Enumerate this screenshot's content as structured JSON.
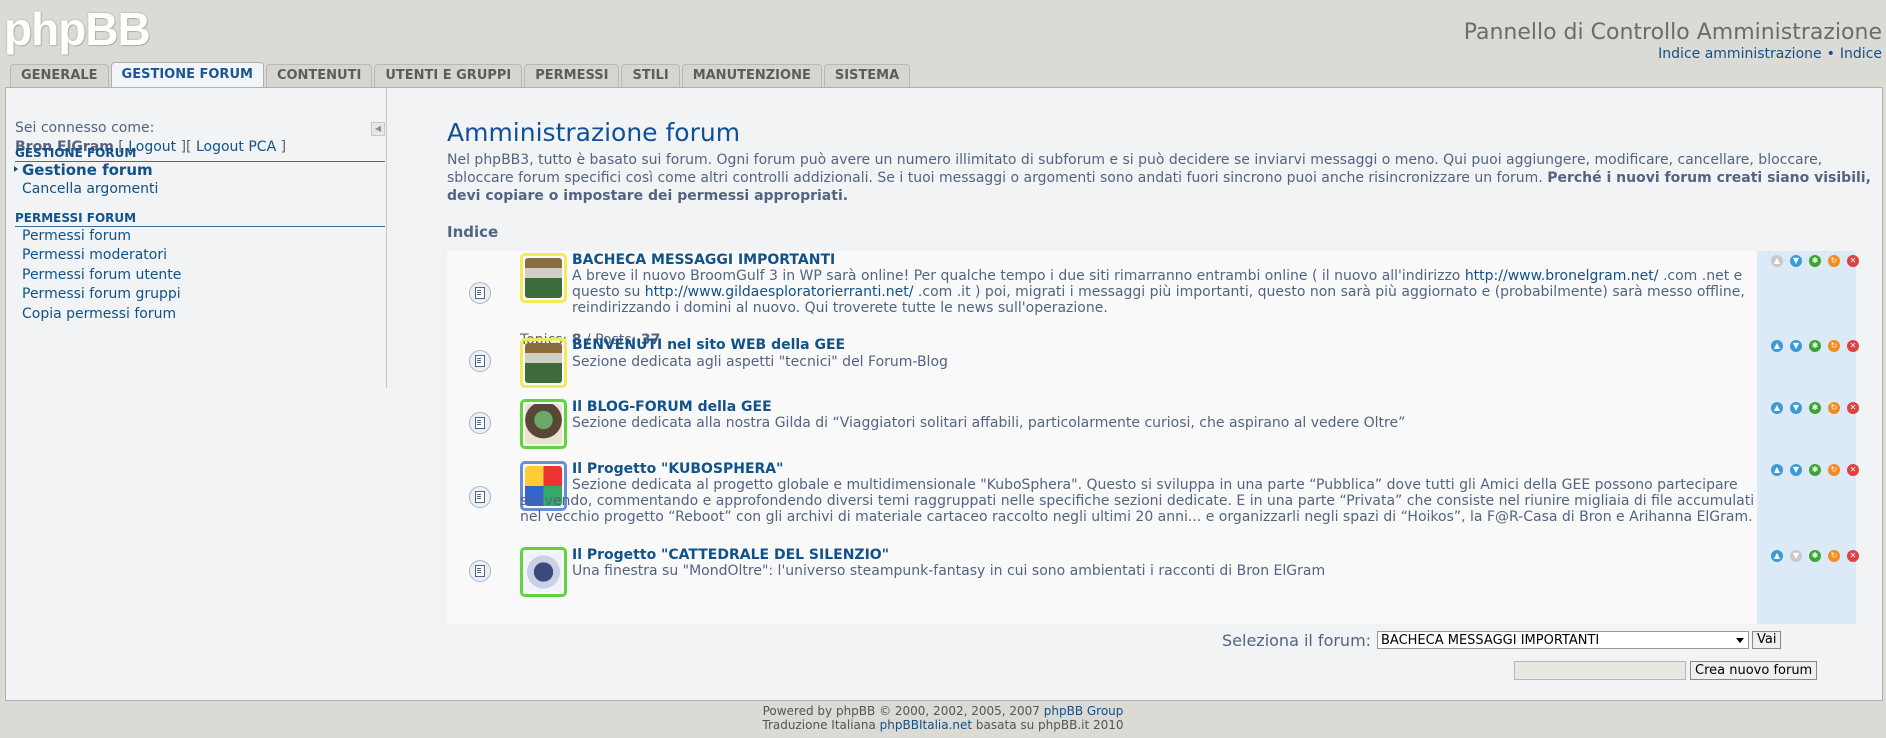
{
  "header": {
    "logo_text": "phpBB",
    "title": "Pannello di Controllo Amministrazione",
    "links": [
      "Indice amministrazione",
      "Indice"
    ],
    "link_separator": "•"
  },
  "tabs": [
    {
      "label": "GENERALE",
      "active": false
    },
    {
      "label": "GESTIONE FORUM",
      "active": true
    },
    {
      "label": "CONTENUTI",
      "active": false
    },
    {
      "label": "UTENTI E GRUPPI",
      "active": false
    },
    {
      "label": "PERMESSI",
      "active": false
    },
    {
      "label": "STILI",
      "active": false
    },
    {
      "label": "MANUTENZIONE",
      "active": false
    },
    {
      "label": "SISTEMA",
      "active": false
    }
  ],
  "sidebar": {
    "logged_label": "Sei connesso come:",
    "username": "Bron ElGram",
    "logout": "Logout",
    "logout_pca": "Logout PCA",
    "sections": [
      {
        "title": "GESTIONE FORUM",
        "items": [
          {
            "label": "Gestione forum",
            "active": true
          },
          {
            "label": "Cancella argomenti",
            "active": false
          }
        ]
      },
      {
        "title": "PERMESSI FORUM",
        "items": [
          {
            "label": "Permessi forum",
            "active": false
          },
          {
            "label": "Permessi moderatori",
            "active": false
          },
          {
            "label": "Permessi forum utente",
            "active": false
          },
          {
            "label": "Permessi forum gruppi",
            "active": false
          },
          {
            "label": "Copia permessi forum",
            "active": false
          }
        ]
      }
    ]
  },
  "main": {
    "title": "Amministrazione forum",
    "intro": "Nel phpBB3, tutto è basato sui forum. Ogni forum può avere un numero illimitato di subforum e si può decidere se inviarvi messaggi o meno. Qui puoi aggiungere, modificare, cancellare, bloccare, sbloccare forum specifici così come altri controlli addizionali. Se i tuoi messaggi o argomenti sono andati fuori sincrono puoi anche risincronizzare un forum.",
    "intro_bold": "Perché i nuovi forum creati siano visibili, devi copiare o impostare dei permessi appropriati.",
    "breadcrumb": "Indice",
    "forums": [
      {
        "title": "BACHECA MESSAGGI IMPORTANTI",
        "desc_parts": [
          "A breve il nuovo BroomGulf 3 in WP sarà online! Per qualche tempo i due siti rimarranno entrambi online ( il nuovo all'indirizzo ",
          "http://www.bronelgram.net/",
          " .com .net e questo su ",
          "http://www.gildaesploratorierranti.net/",
          " .com .it ) poi, migrati i messaggi più importanti, questo non sarà più aggiornato e (probabilmente) sarà messo offline, reindirizzando i domini al nuovo. Qui troverete tutte le news sull'operazione."
        ],
        "topics_label": "Topics:",
        "topics": "8",
        "posts_label": "Posts:",
        "posts": "37",
        "border": "yellow",
        "up_disabled": true,
        "down_disabled": false
      },
      {
        "title": "BENVENUTI nel sito WEB della GEE",
        "desc": "Sezione dedicata agli aspetti \"tecnici\" del Forum-Blog",
        "border": "yellow",
        "up_disabled": false,
        "down_disabled": false
      },
      {
        "title": "Il BLOG-FORUM della GEE",
        "desc": "Sezione dedicata alla nostra Gilda di “Viaggiatori solitari affabili, particolarmente curiosi, che aspirano al vedere Oltre”",
        "border": "green",
        "up_disabled": false,
        "down_disabled": false
      },
      {
        "title": "Il Progetto \"KUBOSPHERA\"",
        "desc": "Sezione dedicata al progetto globale e multidimensionale \"KuboSphera\". Questo si sviluppa in una parte “Pubblica” dove tutti gli Amici della GEE possono partecipare scrivendo, commentando e approfondendo diversi temi raggruppati nelle specifiche sezioni dedicate. E in una parte “Privata” che consiste nel riunire migliaia di file accumulati nel vecchio progetto “Reboot” con gli archivi di materiale cartaceo raccolto negli ultimi 20 anni... e organizzarli negli spazi di “Hoikos”, la F@R-Casa di Bron e Arihanna ElGram.",
        "border": "blue",
        "up_disabled": false,
        "down_disabled": false
      },
      {
        "title": "Il Progetto \"CATTEDRALE DEL SILENZIO\"",
        "desc": "Una finestra su \"MondOltre\": l'universo steampunk-fantasy in cui sono ambientati i racconti di Bron ElGram",
        "border": "green",
        "up_disabled": false,
        "down_disabled": true
      }
    ],
    "select_label": "Seleziona il forum:",
    "select_value": "BACHECA MESSAGGI IMPORTANTI",
    "go_button": "Vai",
    "new_forum_value": "",
    "new_forum_button": "Crea nuovo forum"
  },
  "footer": {
    "line1_prefix": "Powered by phpBB © 2000, 2002, 2005, 2007 ",
    "line1_link": "phpBB Group",
    "line2_prefix": "Traduzione Italiana ",
    "line2_link": "phpBBItalia.net",
    "line2_suffix": " basata su phpBB.it 2010"
  },
  "colors": {
    "link": "#105289",
    "text": "#536482",
    "title": "#115098",
    "page_bg": "#dcdad5",
    "actions_bg": "#dce9f7"
  }
}
